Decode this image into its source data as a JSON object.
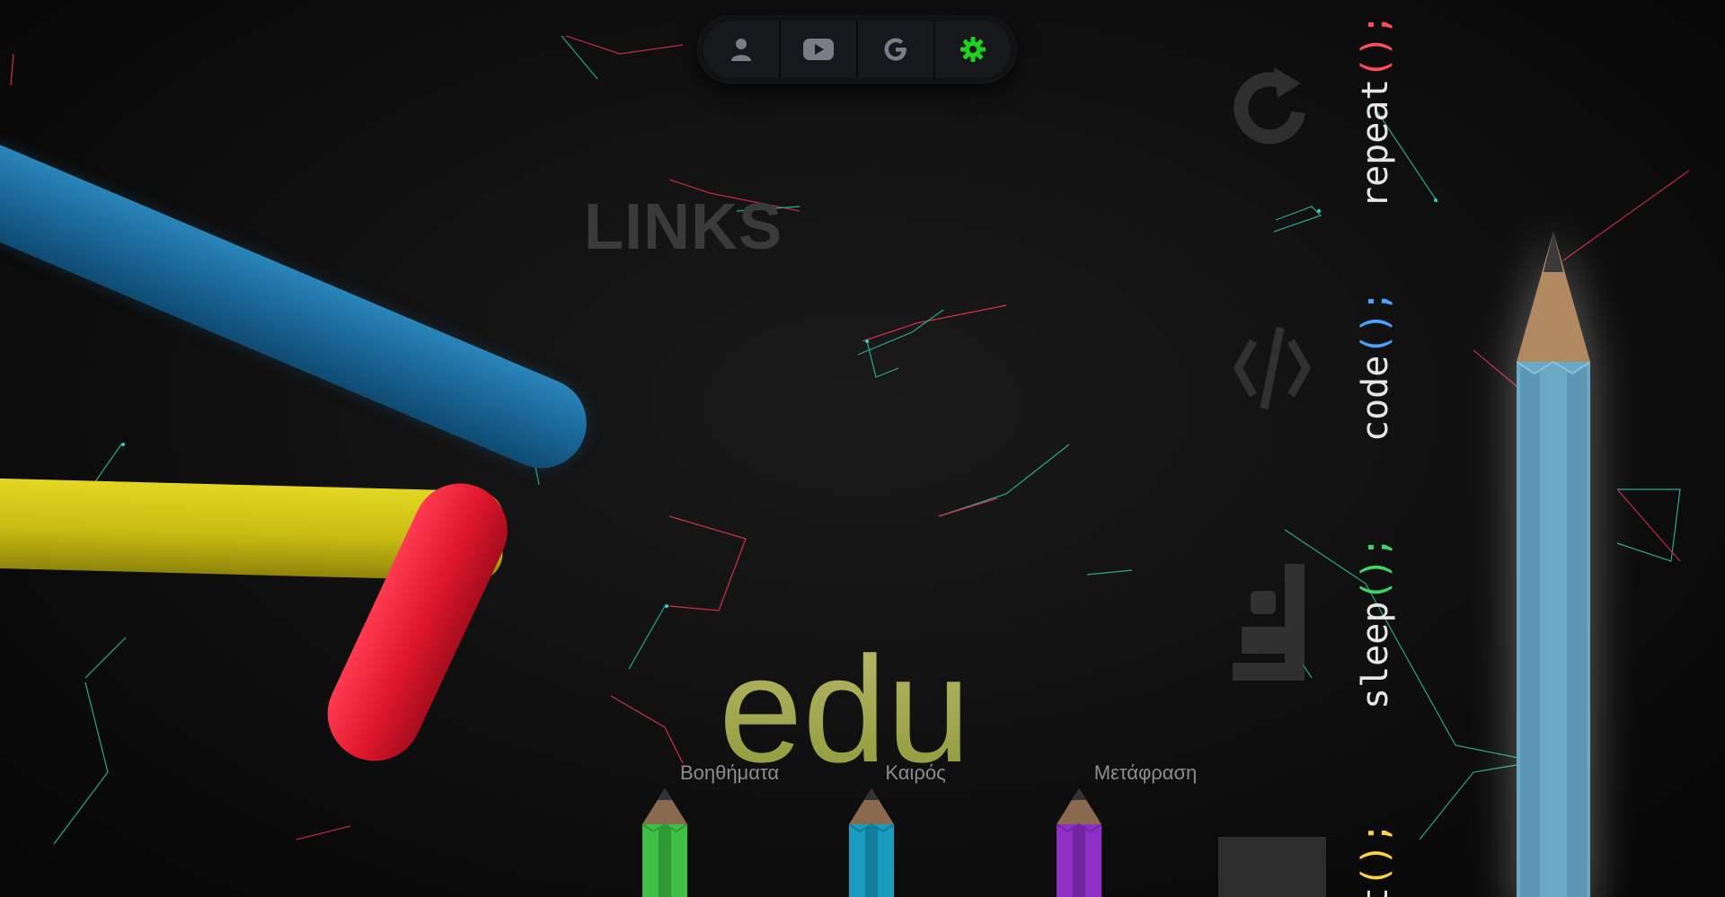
{
  "nav": {
    "buttons": [
      {
        "id": "profile",
        "icon": "person-icon"
      },
      {
        "id": "youtube",
        "icon": "youtube-icon"
      },
      {
        "id": "google",
        "icon": "google-icon"
      },
      {
        "id": "settings",
        "icon": "gear-icon",
        "accent": "#1fd11f"
      }
    ]
  },
  "links_title": "LINKS",
  "edu_title": "edu",
  "pencils": [
    {
      "label": "Βοηθήματα",
      "color": "#3fbf45"
    },
    {
      "label": "Καιρός",
      "color": "#1a9cc0"
    },
    {
      "label": "Μετάφραση",
      "color": "#8e2fc6"
    }
  ],
  "code_words": [
    {
      "fn": "repeat",
      "punct": "();",
      "paren_color": "#ff4c5a"
    },
    {
      "fn": "code",
      "punct": "();",
      "paren_color": "#4aa4ff"
    },
    {
      "fn": "sleep",
      "punct": "();",
      "paren_color": "#3fd46a"
    },
    {
      "fn": "t",
      "punct": "();",
      "paren_color": "#ffd23f"
    }
  ],
  "colors": {
    "background": "#0b0b0b",
    "edu": "#9aa14a",
    "big_pencil": "#6aa8c6"
  }
}
